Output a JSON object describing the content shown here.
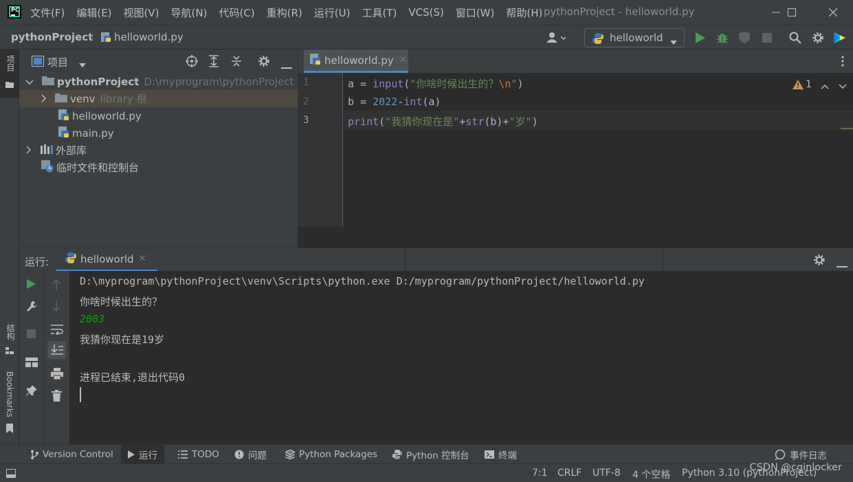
{
  "app": {
    "logo_text": "PC",
    "window_title": "pythonProject - helloworld.py"
  },
  "menu": [
    "文件(F)",
    "编辑(E)",
    "视图(V)",
    "导航(N)",
    "代码(C)",
    "重构(R)",
    "运行(U)",
    "工具(T)",
    "VCS(S)",
    "窗口(W)",
    "帮助(H)"
  ],
  "navbar": {
    "project": "pythonProject",
    "file": "helloworld.py",
    "run_config": "helloworld"
  },
  "left_strip": {
    "project": "项目",
    "structure": "结构",
    "bookmarks": "Bookmarks"
  },
  "project_panel": {
    "title": "项目",
    "tree": [
      {
        "name": "pythonProject",
        "hint": "D:\\myprogram\\pythonProject"
      },
      {
        "name": "venv",
        "hint": "library 根"
      },
      {
        "name": "helloworld.py"
      },
      {
        "name": "main.py"
      },
      {
        "name": "外部库"
      },
      {
        "name": "临时文件和控制台"
      }
    ]
  },
  "editor": {
    "tab": "helloworld.py",
    "warning_count": "1",
    "line_numbers": [
      "1",
      "2",
      "3"
    ]
  },
  "run": {
    "label": "运行:",
    "tab": "helloworld",
    "console": [
      "D:\\myprogram\\pythonProject\\venv\\Scripts\\python.exe D:/myprogram/pythonProject/helloworld.py",
      "你啥时候出生的？",
      "2003",
      "我猜你现在是19岁",
      "",
      "进程已结束,退出代码0"
    ]
  },
  "tool_windows": [
    "Version Control",
    "运行",
    "TODO",
    "问题",
    "Python Packages",
    "Python 控制台",
    "终端",
    "事件日志"
  ],
  "status": {
    "position": "7:1",
    "line_sep": "CRLF",
    "encoding": "UTF-8",
    "indent": "4 个空格",
    "interpreter": "Python 3.10 (pythonProject)",
    "watermark": "CSDN @cginlocker"
  },
  "colors": {
    "accent": "#4a88c7",
    "run_green": "#499c54",
    "console_input": "#00aa00"
  }
}
